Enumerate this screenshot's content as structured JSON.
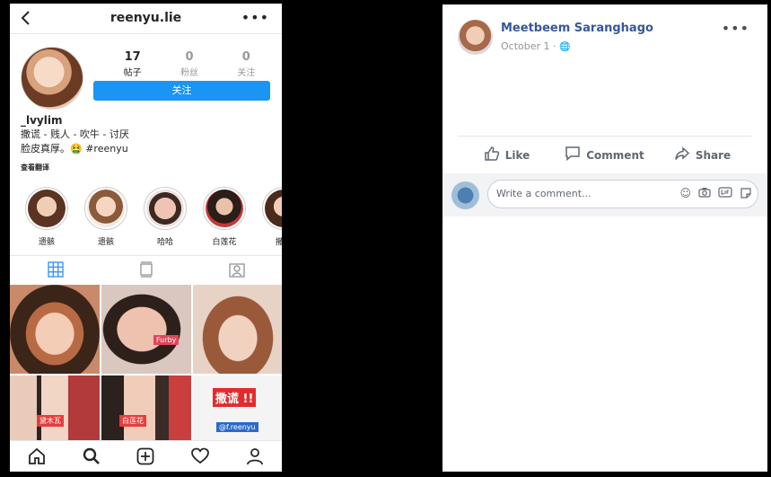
{
  "instagram": {
    "username": "reenyu.lie",
    "more": "•••",
    "stats": [
      {
        "count": "17",
        "label": "帖子"
      },
      {
        "count": "0",
        "label": "粉丝"
      },
      {
        "count": "0",
        "label": "关注"
      }
    ],
    "follow_label": "关注",
    "bio": {
      "name": "_lvylim",
      "line1": "撒谎 - 贱人 - 吹牛 - 讨厌",
      "line2": "脸皮真厚。🤮 #reenyu",
      "translate": "查看翻译"
    },
    "highlights": [
      "遗骸",
      "遗骸",
      "哈哈",
      "白莲花",
      "撒谎"
    ],
    "grid_tags": [
      "Furby",
      "黛木瓦",
      "白莲花",
      "撒谎 !!",
      "@f.reenyu"
    ],
    "accent": "#1a95f3"
  },
  "facebook": {
    "name": "Meetbeem Saranghago",
    "date": "October 1 · ",
    "more": "•••",
    "actions": {
      "like": "Like",
      "comment": "Comment",
      "share": "Share"
    },
    "comment_placeholder": "Write a comment...",
    "name_color": "#365899"
  }
}
